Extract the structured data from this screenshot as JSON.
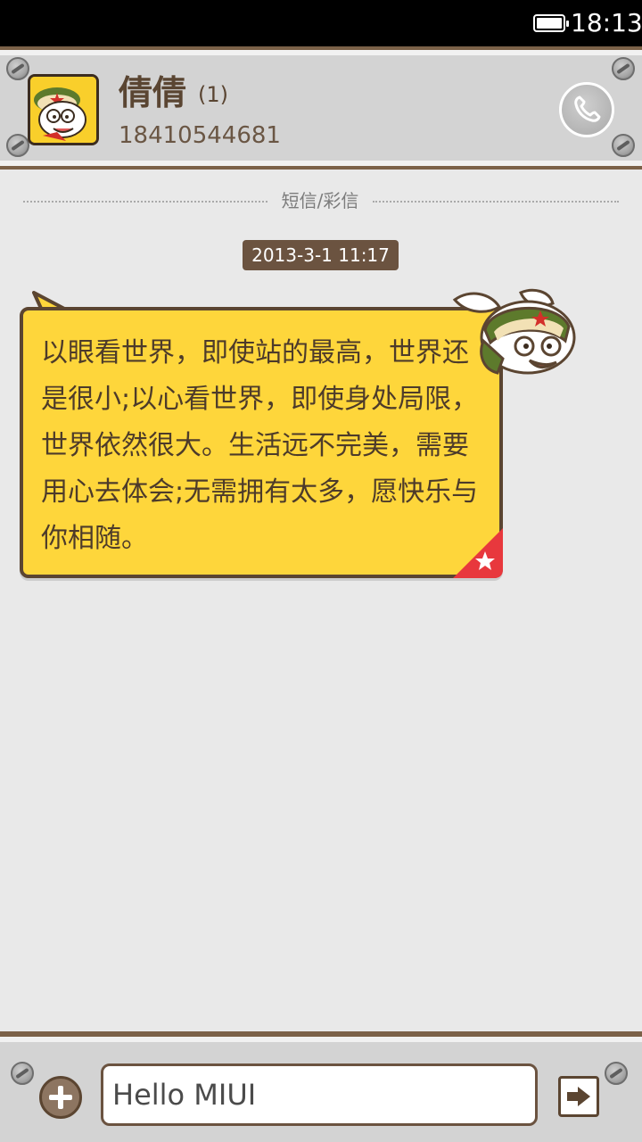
{
  "status_bar": {
    "time": "18:13",
    "icons": [
      "battery-icon"
    ]
  },
  "header": {
    "contact_name": "倩倩",
    "unread_count": "(1)",
    "contact_number": "18410544681",
    "icons": [
      "avatar-mascot",
      "phone-icon"
    ]
  },
  "conversation": {
    "channel_label": "短信/彩信",
    "timestamp": "2013-3-1 11:17",
    "messages": [
      {
        "direction": "incoming",
        "text": "以眼看世界，即使站的最高，世界还是很小;以心看世界，即使身处局限，世界依然很大。生活远不完美，需要用心去体会;无需拥有太多，愿快乐与你相随。",
        "icons": [
          "mascot-sticker",
          "star-icon"
        ]
      }
    ]
  },
  "composer": {
    "input_value": "Hello MIUI",
    "icons": [
      "add-icon",
      "send-icon"
    ]
  },
  "colors": {
    "frame_brown": "#7b6148",
    "bubble_yellow": "#fed63b",
    "panel_gray": "#d3d3d3",
    "background": "#e9e9e9",
    "timestamp_bg": "#6b5340",
    "corner_red": "#e8383d"
  }
}
